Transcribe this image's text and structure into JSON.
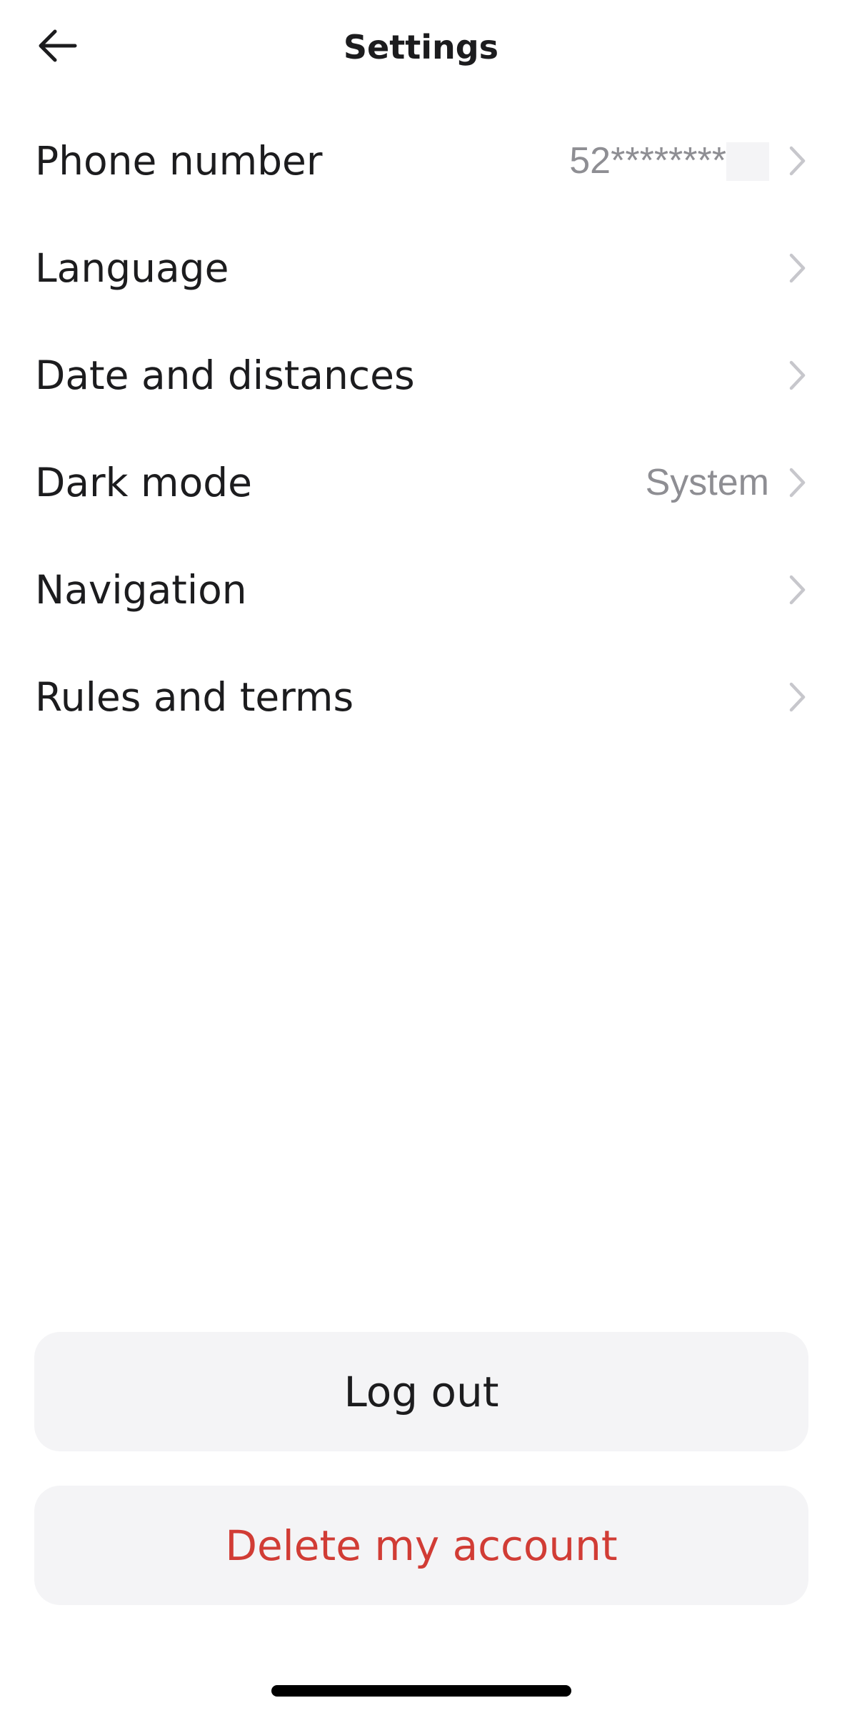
{
  "header": {
    "title": "Settings",
    "back_icon": "arrow-left-icon"
  },
  "settings": {
    "items": [
      {
        "label": "Phone number",
        "value": "52********",
        "icon": "chevron-right-icon"
      },
      {
        "label": "Language",
        "value": "",
        "icon": "chevron-right-icon"
      },
      {
        "label": "Date and distances",
        "value": "",
        "icon": "chevron-right-icon"
      },
      {
        "label": "Dark mode",
        "value": "System",
        "icon": "chevron-right-icon"
      },
      {
        "label": "Navigation",
        "value": "",
        "icon": "chevron-right-icon"
      },
      {
        "label": "Rules and terms",
        "value": "",
        "icon": "chevron-right-icon"
      }
    ]
  },
  "actions": {
    "logout_label": "Log out",
    "delete_label": "Delete my account"
  },
  "colors": {
    "text_primary": "#1c1c1e",
    "text_secondary": "#8e8e93",
    "chevron": "#c7c7cc",
    "button_bg": "#f4f4f6",
    "danger": "#d13c35"
  }
}
